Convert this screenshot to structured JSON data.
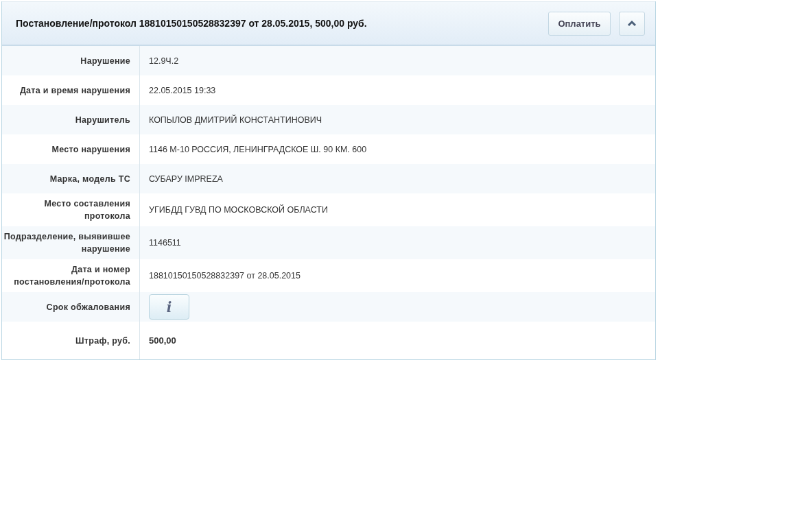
{
  "header": {
    "title": "Постановление/протокол 18810150150528832397 от 28.05.2015, 500,00 руб.",
    "pay_button": "Оплатить",
    "expanded": true
  },
  "rows": [
    {
      "label": "Нарушение",
      "kind": "text",
      "value": "12.9Ч.2"
    },
    {
      "label": "Дата и время нарушения",
      "kind": "text",
      "value": "22.05.2015 19:33"
    },
    {
      "label": "Нарушитель",
      "kind": "text",
      "value": "КОПЫЛОВ ДМИТРИЙ КОНСТАНТИНОВИЧ"
    },
    {
      "label": "Место нарушения",
      "kind": "text",
      "value": "1146 М-10 РОССИЯ, ЛЕНИНГРАДСКОЕ Ш. 90 КМ. 600"
    },
    {
      "label": "Марка, модель ТС",
      "kind": "text",
      "value": "СУБАРУ IMPREZA"
    },
    {
      "label": "Место составления протокола",
      "kind": "text",
      "value": "УГИБДД ГУВД ПО МОСКОВСКОЙ ОБЛАСТИ"
    },
    {
      "label": "Подразделение, выявившее нарушение",
      "kind": "text",
      "value": "1146511"
    },
    {
      "label": "Дата и номер постановления/протокола",
      "kind": "text",
      "value": "18810150150528832397 от 28.05.2015"
    },
    {
      "label": "Срок обжалования",
      "kind": "info",
      "value": "i"
    },
    {
      "label": "Штраф, руб.",
      "kind": "total",
      "value": "500,00"
    }
  ]
}
